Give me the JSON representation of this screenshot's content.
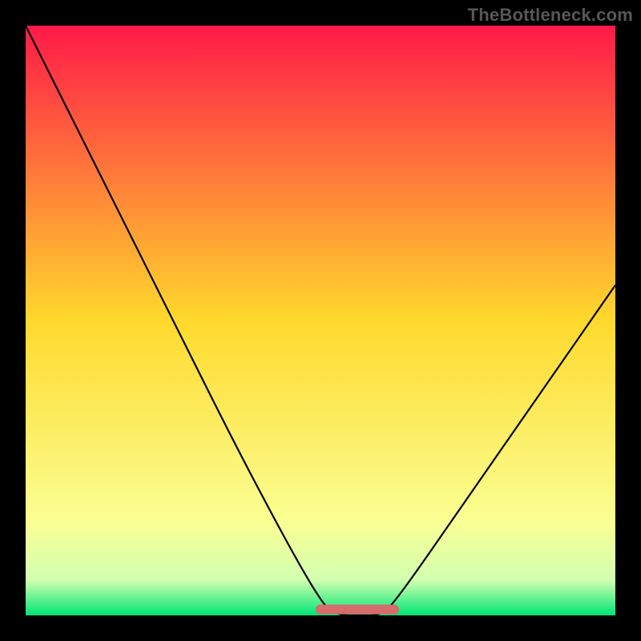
{
  "watermark": "TheBottleneck.com",
  "chart_data": {
    "type": "line",
    "title": "",
    "xlabel": "",
    "ylabel": "",
    "xlim": [
      0,
      100
    ],
    "ylim": [
      0,
      100
    ],
    "x": [
      0,
      12.5,
      25,
      37.5,
      50,
      53,
      57,
      60,
      62.5,
      75,
      87.5,
      100
    ],
    "values": [
      100,
      75,
      50,
      25,
      2,
      0,
      0,
      0,
      2,
      20,
      38,
      56
    ],
    "minimum_band": {
      "x_start": 50,
      "x_end": 62.5,
      "y": 1
    },
    "background_gradient": {
      "stops": [
        {
          "offset": 0.0,
          "color": "#ff1948"
        },
        {
          "offset": 0.5,
          "color": "#ffd92c"
        },
        {
          "offset": 0.84,
          "color": "#faff93"
        },
        {
          "offset": 0.94,
          "color": "#d2ffb0"
        },
        {
          "offset": 1.0,
          "color": "#00e676"
        }
      ]
    },
    "curve_color": "#000000",
    "marker_color": "#d86b6b"
  }
}
